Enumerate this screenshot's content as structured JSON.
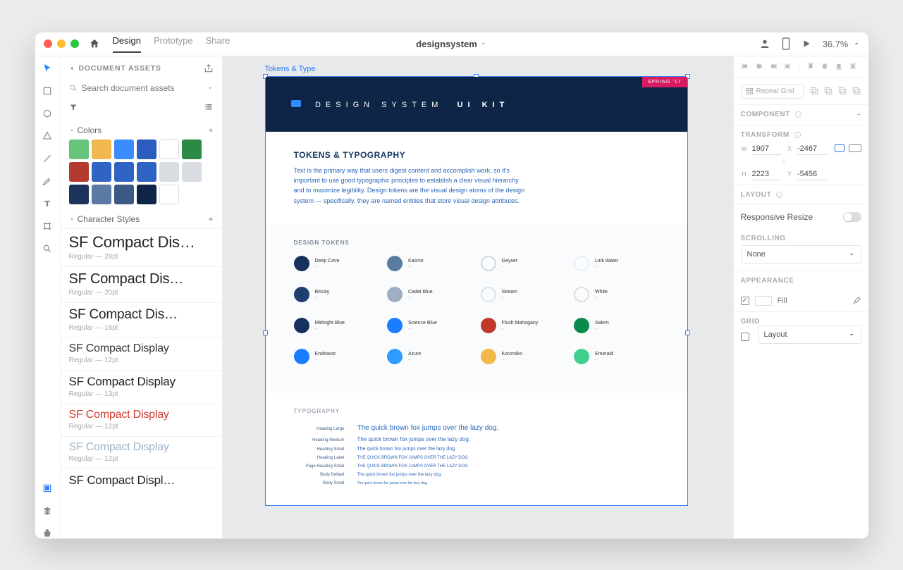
{
  "titlebar": {
    "tabs": {
      "design": "Design",
      "prototype": "Prototype",
      "share": "Share"
    },
    "doc_name": "designsystem",
    "zoom": "36.7%"
  },
  "assets": {
    "title": "DOCUMENT ASSETS",
    "search_placeholder": "Search document assets",
    "colors_label": "Colors",
    "colors": [
      "#67c47a",
      "#f0b84f",
      "#3b8cff",
      "#2a5dbd",
      "#ffffff",
      "#2d8a46",
      "#b23a2f",
      "#2f63c4",
      "#2f63c4",
      "#2f63c4",
      "#d9dde2",
      "#d9dde2",
      "#1c335b",
      "#5a7aa3",
      "#3b5886",
      "#0f2547",
      "#ffffff"
    ],
    "charstyles_label": "Character Styles",
    "charstyles": [
      {
        "name": "SF Compact Dis…",
        "meta": "Regular — 28pt",
        "size": 22,
        "color": "#222"
      },
      {
        "name": "SF Compact Dis…",
        "meta": "Regular — 20pt",
        "size": 20,
        "color": "#222"
      },
      {
        "name": "SF Compact Dis…",
        "meta": "Regular — 16pt",
        "size": 19,
        "color": "#222"
      },
      {
        "name": "SF Compact Display",
        "meta": "Regular — 12pt",
        "size": 16,
        "color": "#333"
      },
      {
        "name": "SF Compact Display",
        "meta": "Regular — 13pt",
        "size": 17,
        "color": "#222"
      },
      {
        "name": "SF Compact Display",
        "meta": "Regular — 12pt",
        "size": 16,
        "color": "#d23b2f"
      },
      {
        "name": "SF Compact Display",
        "meta": "Regular — 12pt",
        "size": 16,
        "color": "#9fb2c9"
      },
      {
        "name": "SF Compact Displ…",
        "meta": "",
        "size": 17,
        "color": "#222"
      }
    ]
  },
  "artboard": {
    "label": "Tokens & Type",
    "badge": "SPRING '17",
    "kit_a": "DESIGN SYSTEM",
    "kit_b": "UI KIT",
    "h3": "TOKENS & TYPOGRAPHY",
    "copy": "Text is the primary way that users digest content and accomplish work, so it's important to use good typographic principles to establish a clear visual hierarchy and to maximize legibility. Design tokens are the visual design atoms of the design system — specifically, they are named entities that store visual design attributes.",
    "tokens_head": "DESIGN TOKENS",
    "tokens": [
      {
        "c": "#17315c",
        "n": "Deep Cove"
      },
      {
        "c": "#5a7ca3",
        "n": "Kasmir"
      },
      {
        "c": "#cfd8e1",
        "n": "Geyser",
        "ring": true
      },
      {
        "c": "#e7eef6",
        "n": "Link Water",
        "ring": true
      },
      {
        "c": "#1f3e70",
        "n": "Biscay"
      },
      {
        "c": "#9cafc3",
        "n": "Cadet Blue"
      },
      {
        "c": "#d9e3eb",
        "n": "Stream",
        "ring": true
      },
      {
        "c": "#ffffff",
        "n": "White",
        "ring": true
      },
      {
        "c": "#163060",
        "n": "Midnight Blue"
      },
      {
        "c": "#1a7cff",
        "n": "Science Blue"
      },
      {
        "c": "#c0392b",
        "n": "Flush Mahogany"
      },
      {
        "c": "#0b8a4b",
        "n": "Salem"
      },
      {
        "c": "#1a7cff",
        "n": "Endeavor"
      },
      {
        "c": "#2d9bff",
        "n": "Azure"
      },
      {
        "c": "#f2b84b",
        "n": "Koromiko"
      },
      {
        "c": "#3fd08e",
        "n": "Emerald"
      }
    ],
    "typo_head": "TYPOGRAPHY",
    "typo": [
      {
        "label": "Heading Large",
        "sample": "The quick brown fox jumps over the lazy dog.",
        "size": 10
      },
      {
        "label": "Heading Medium",
        "sample": "The quick brown fox jumps over the lazy dog.",
        "size": 8
      },
      {
        "label": "Heading Small",
        "sample": "The quick brown fox jumps over the lazy dog.",
        "size": 7
      },
      {
        "label": "Heading Label",
        "sample": "THE QUICK BROWN FOX JUMPS OVER THE LAZY DOG",
        "size": 6
      },
      {
        "label": "Page Heading Small",
        "sample": "THE QUICK BROWN FOX JUMPS OVER THE LAZY DOG",
        "size": 6
      },
      {
        "label": "Body Default",
        "sample": "The quick brown fox jumps over the lazy dog.",
        "size": 6
      },
      {
        "label": "Body Small",
        "sample": "The quick brown fox jumps over the lazy dog.",
        "size": 5
      }
    ]
  },
  "inspector": {
    "repeat": "Repeat Grid",
    "component": "COMPONENT",
    "transform": "TRANSFORM",
    "w": "1907",
    "h": "2223",
    "x": "-2467",
    "y": "-5456",
    "layout": "LAYOUT",
    "responsive": "Responsive Resize",
    "scrolling": "SCROLLING",
    "scroll_value": "None",
    "appearance": "APPEARANCE",
    "fill": "Fill",
    "grid": "GRID",
    "grid_value": "Layout"
  }
}
